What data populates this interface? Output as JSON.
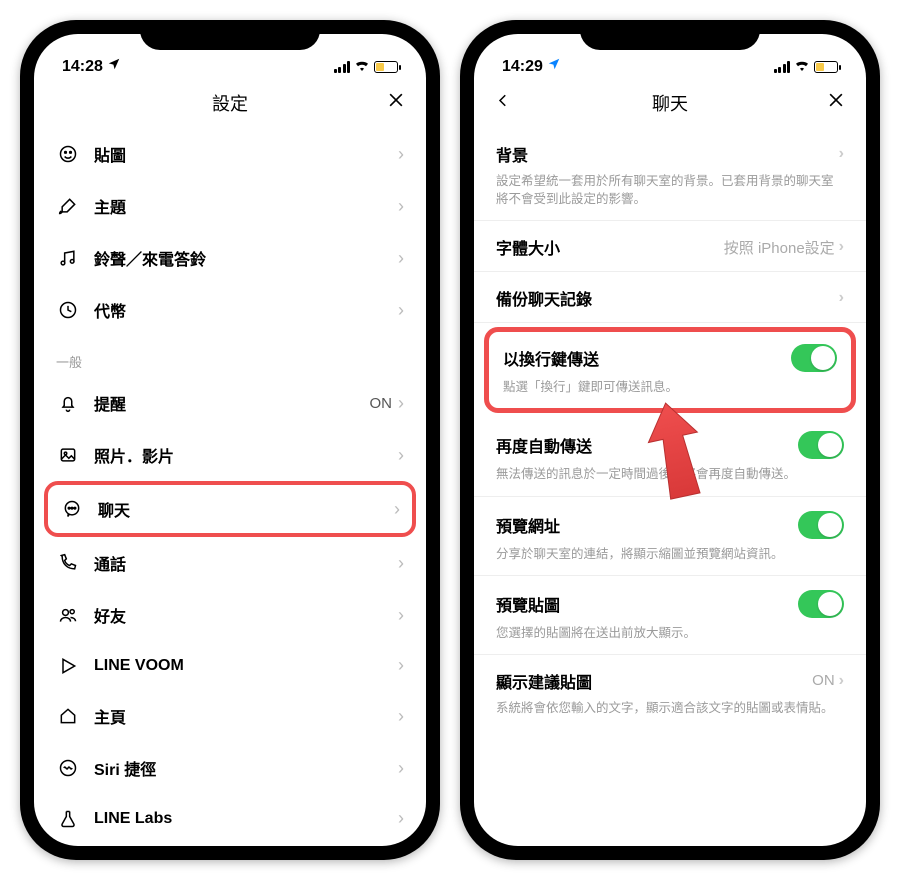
{
  "left": {
    "status": {
      "time": "14:28"
    },
    "header": {
      "title": "設定"
    },
    "section1": [
      {
        "icon": "smile",
        "label": "貼圖"
      },
      {
        "icon": "brush",
        "label": "主題"
      },
      {
        "icon": "music",
        "label": "鈴聲／來電答鈴"
      },
      {
        "icon": "clock",
        "label": "代幣"
      }
    ],
    "section_general_title": "一般",
    "section2": [
      {
        "icon": "bell",
        "label": "提醒",
        "value": "ON"
      },
      {
        "icon": "photo",
        "label": "照片．影片"
      },
      {
        "icon": "chat",
        "label": "聊天",
        "highlight": true
      },
      {
        "icon": "phone",
        "label": "通話"
      },
      {
        "icon": "friends",
        "label": "好友"
      },
      {
        "icon": "voom",
        "label": "LINE VOOM"
      },
      {
        "icon": "home",
        "label": "主頁"
      },
      {
        "icon": "siri",
        "label": "Siri 捷徑"
      },
      {
        "icon": "flask",
        "label": "LINE Labs"
      }
    ]
  },
  "right": {
    "status": {
      "time": "14:29"
    },
    "header": {
      "title": "聊天"
    },
    "blocks": {
      "background": {
        "title": "背景",
        "desc": "設定希望統一套用於所有聊天室的背景。已套用背景的聊天室將不會受到此設定的影響。"
      },
      "fontsize": {
        "title": "字體大小",
        "value": "按照 iPhone設定"
      },
      "backup": {
        "title": "備份聊天記錄"
      },
      "send_enter": {
        "title": "以換行鍵傳送",
        "desc": "點選「換行」鍵即可傳送訊息。",
        "toggle": true,
        "highlight": true
      },
      "auto_resend": {
        "title": "再度自動傳送",
        "desc": "無法傳送的訊息於一定時間過後，將會再度自動傳送。",
        "toggle": true
      },
      "preview_url": {
        "title": "預覽網址",
        "desc": "分享於聊天室的連結，將顯示縮圖並預覽網站資訊。",
        "toggle": true
      },
      "preview_stkr": {
        "title": "預覽貼圖",
        "desc": "您選擇的貼圖將在送出前放大顯示。",
        "toggle": true
      },
      "suggest_stkr": {
        "title": "顯示建議貼圖",
        "value": "ON",
        "desc": "系統將會依您輸入的文字，顯示適合該文字的貼圖或表情貼。"
      }
    }
  }
}
